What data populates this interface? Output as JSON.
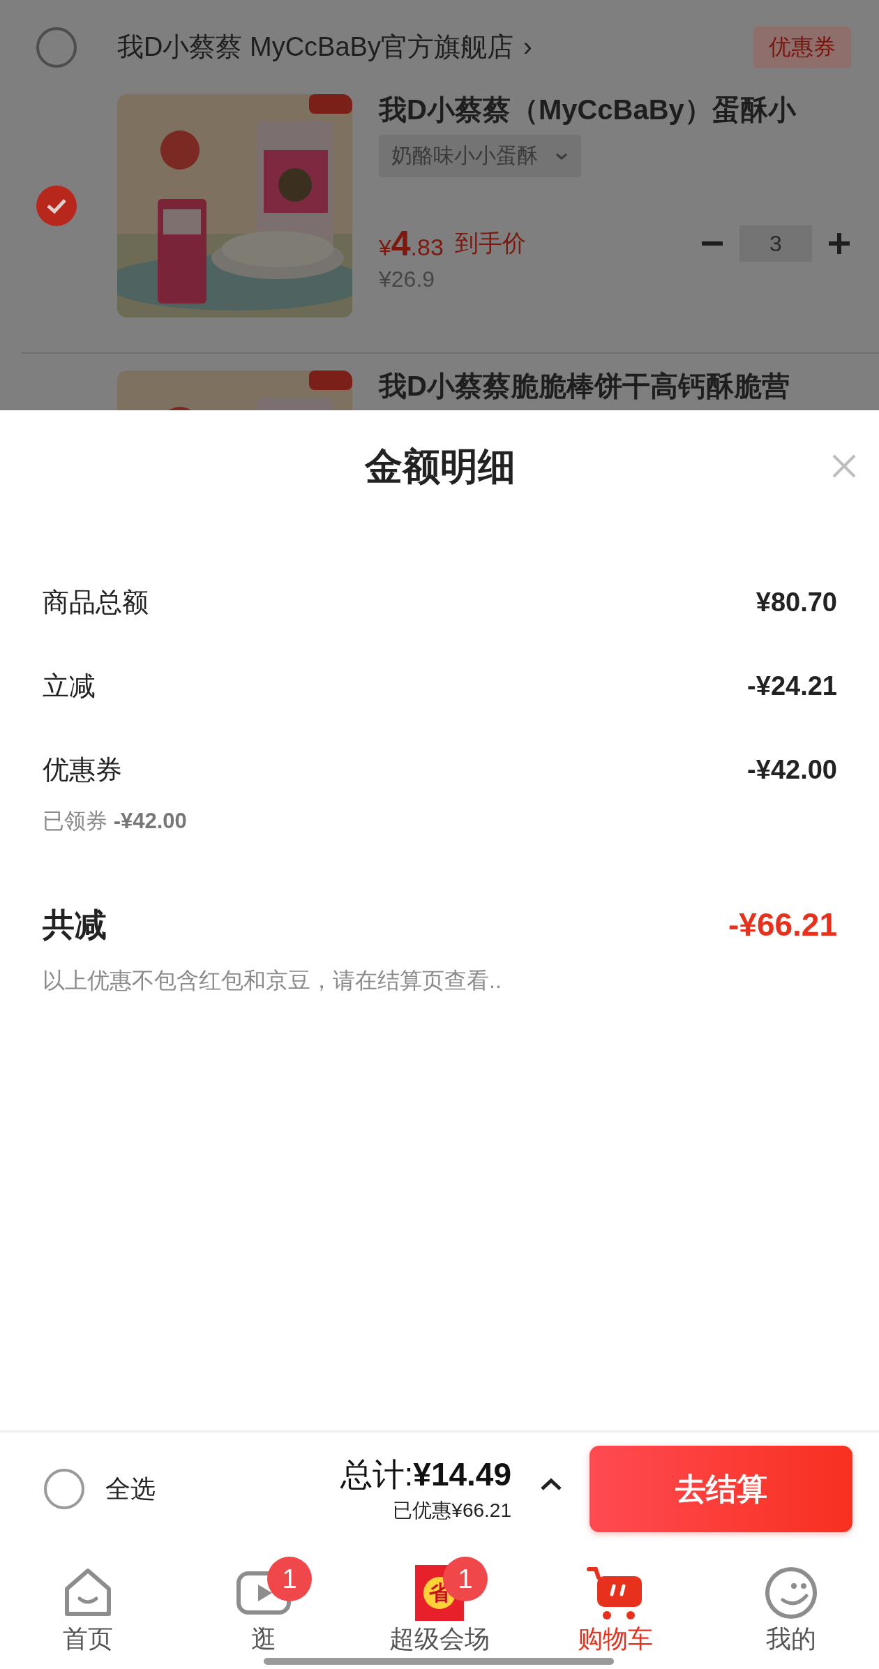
{
  "store": {
    "checked": false,
    "name": "我D小蔡蔡 MyCcBaBy官方旗舰店",
    "arrow": "›",
    "coupon_button": "优惠券"
  },
  "products": [
    {
      "kind": "full",
      "checked": true,
      "title": "我D小蔡蔡（MyCcBaBy）蛋酥小",
      "variant": "奶酪味小小蛋酥",
      "price_symbol": "¥",
      "price_int": "4",
      "price_dec": ".83",
      "price_label": "到手价",
      "original_price": "¥26.9",
      "quantity": "3"
    },
    {
      "kind": "partial",
      "title": "我D小蔡蔡脆脆棒饼干高钙酥脆营"
    }
  ],
  "sheet": {
    "title": "金额明细",
    "rows": [
      {
        "label": "商品总额",
        "amount": "¥80.70"
      },
      {
        "label": "立减",
        "amount": "-¥24.21"
      },
      {
        "label": "优惠券",
        "amount": "-¥42.00",
        "note": "已领券 **-¥42.00**"
      }
    ],
    "total": {
      "label": "共减",
      "amount": "-¥66.21"
    },
    "disclaimer": "以上优惠不包含红包和京豆，请在结算页查看.."
  },
  "footer": {
    "select_all": {
      "label": "全选",
      "checked": false
    },
    "total": "总计:**¥14.49**",
    "saved": "已优惠¥66.21",
    "checkout": "去结算"
  },
  "tabs": [
    {
      "kind": "home",
      "label": "首页",
      "selected": false
    },
    {
      "kind": "video",
      "label": "逛",
      "selected": false,
      "badge": "1"
    },
    {
      "kind": "promo",
      "label": "超级会场",
      "selected": false,
      "badge": "1",
      "icon_text": "省"
    },
    {
      "kind": "cart",
      "label": "购物车",
      "selected": true
    },
    {
      "kind": "profile",
      "label": "我的",
      "selected": false
    }
  ]
}
